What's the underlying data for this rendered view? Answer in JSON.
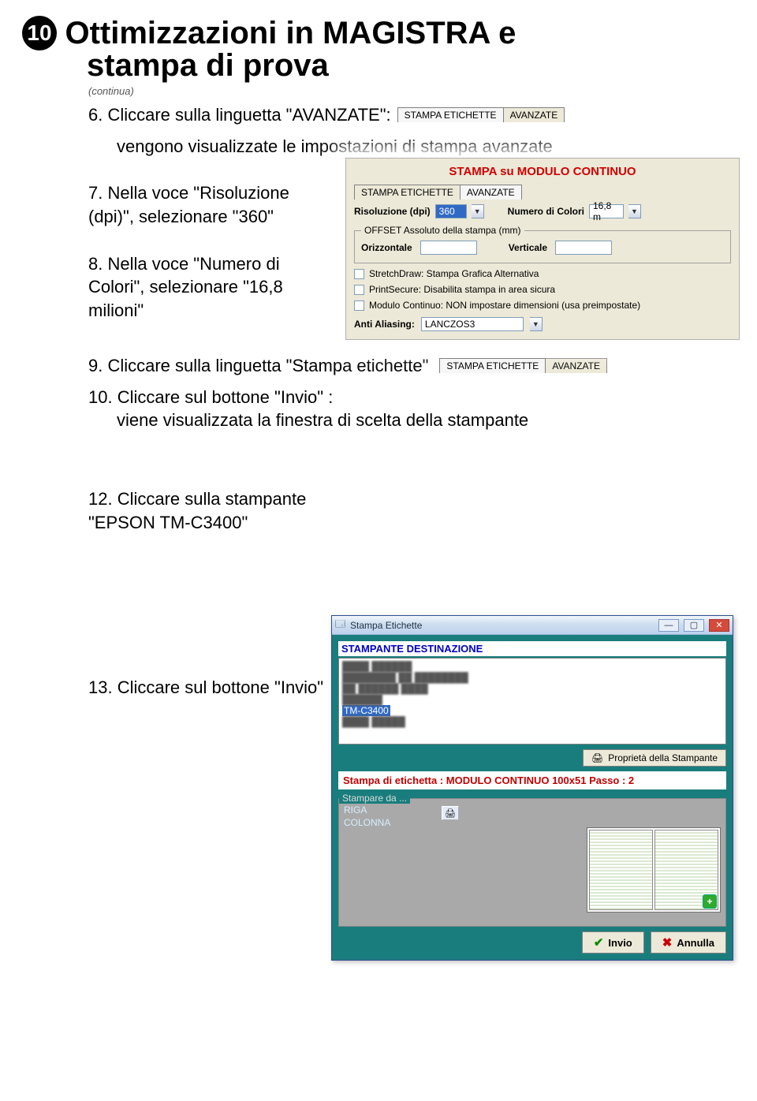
{
  "header": {
    "num": "10",
    "title_line1": "Ottimizzazioni in MAGISTRA e",
    "title_line2": "stampa di prova",
    "continua": "(continua)"
  },
  "steps": {
    "s6": "6. Cliccare sulla linguetta \"AVANZATE\":",
    "s6_sub": "vengono visualizzate le impostazioni di stampa avanzate",
    "s7": "7. Nella voce \"Risoluzione (dpi)\", selezionare \"360\"",
    "s8": "8. Nella voce \"Numero di Colori\", selezionare \"16,8 milioni\"",
    "s9": "9. Cliccare sulla linguetta \"Stampa etichette\"",
    "s10": "10. Cliccare sul bottone \"Invio\" :",
    "s10_sub": "viene visualizzata la finestra di scelta della stampante",
    "s12": "12. Cliccare sulla stampante \"EPSON TM-C3400\"",
    "s13": "13. Cliccare sul bottone \"Invio\""
  },
  "tabstrip1": {
    "tab1": "STAMPA ETICHETTE",
    "tab2": "AVANZATE"
  },
  "tabstrip2": {
    "tab1": "STAMPA ETICHETTE",
    "tab2": "AVANZATE"
  },
  "settings": {
    "title": "STAMPA su MODULO CONTINUO",
    "tab1": "STAMPA ETICHETTE",
    "tab2": "AVANZATE",
    "risoluzione_lbl": "Risoluzione (dpi)",
    "risoluzione_val": "360",
    "numcolori_lbl": "Numero di Colori",
    "numcolori_val": "16,8 m",
    "offset_legend": "OFFSET Assoluto della stampa (mm)",
    "orizz": "Orizzontale",
    "vert": "Verticale",
    "chk1": "StretchDraw: Stampa Grafica Alternativa",
    "chk2": "PrintSecure: Disabilita stampa in area sicura",
    "chk3": "Modulo Continuo: NON impostare dimensioni (usa preimpostate)",
    "aa_lbl": "Anti Aliasing:",
    "aa_val": "LANCZOS3"
  },
  "printwin": {
    "title": "Stampa Etichette",
    "dest_title": "STAMPANTE DESTINAZIONE",
    "selected": "TM-C3400",
    "prop_btn": "Proprietà della Stampante",
    "red_strip": "Stampa di etichetta : MODULO CONTINUO 100x51 Passo : 2",
    "stampare_legend": "Stampare da ...",
    "riga": "RIGA",
    "colonna": "COLONNA",
    "invio": "Invio",
    "annulla": "Annulla"
  }
}
